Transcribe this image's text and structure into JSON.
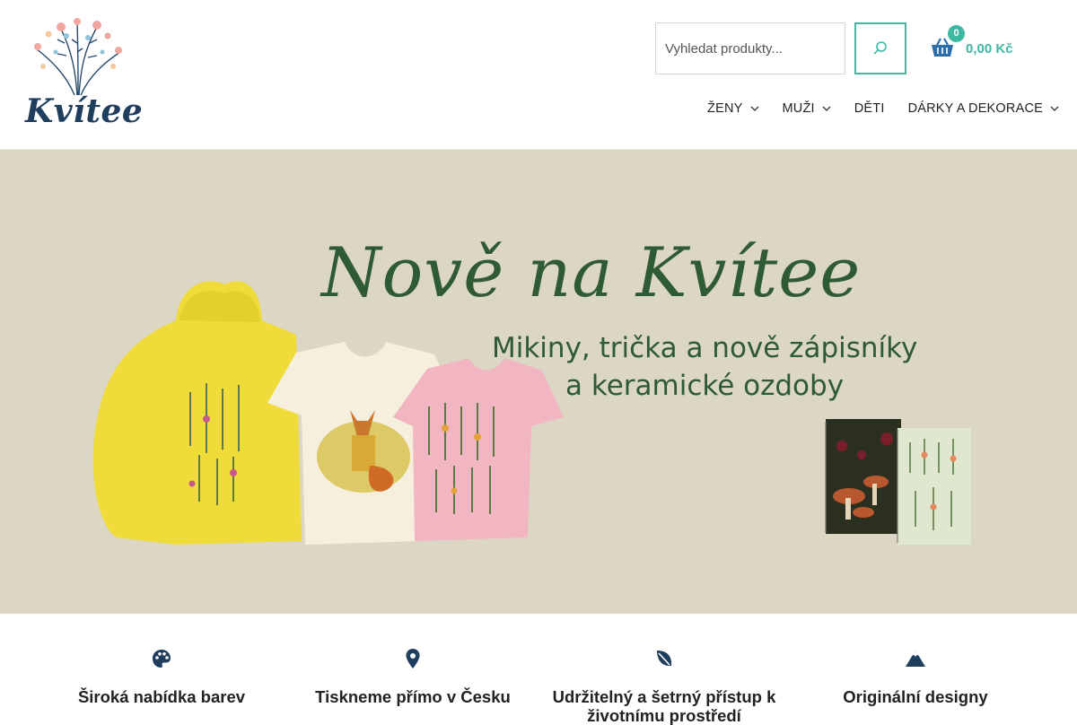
{
  "brand": {
    "name": "Kvítee",
    "logo_icon": "wildflower-bouquet"
  },
  "search": {
    "placeholder": "Vyhledat produkty...",
    "icon": "search-icon"
  },
  "cart": {
    "count": "0",
    "total": "0,00 Kč",
    "icon": "basket-icon"
  },
  "nav": {
    "items": [
      {
        "label": "ŽENY",
        "has_dropdown": true
      },
      {
        "label": "MUŽI",
        "has_dropdown": true
      },
      {
        "label": "DĚTI",
        "has_dropdown": false
      },
      {
        "label": "DÁRKY A DEKORACE",
        "has_dropdown": true
      }
    ]
  },
  "hero": {
    "title": "Nově na Kvítee",
    "subtitle_line1": "Mikiny, trička a nově zápisníky",
    "subtitle_line2": "a keramické ozdoby"
  },
  "features": [
    {
      "icon": "palette-icon",
      "title": "Široká nabídka barev"
    },
    {
      "icon": "map-pin-icon",
      "title": "Tiskneme přímo v Česku"
    },
    {
      "icon": "leaf-icon",
      "title": "Udržitelný a šetrný přístup k životnímu prostředí"
    },
    {
      "icon": "mountain-icon",
      "title": "Originální designy"
    }
  ],
  "colors": {
    "accent": "#3fb8a4",
    "brand_dark": "#1f3d5c",
    "hero_bg": "#dcd6c4",
    "hero_text": "#2e5a34"
  }
}
